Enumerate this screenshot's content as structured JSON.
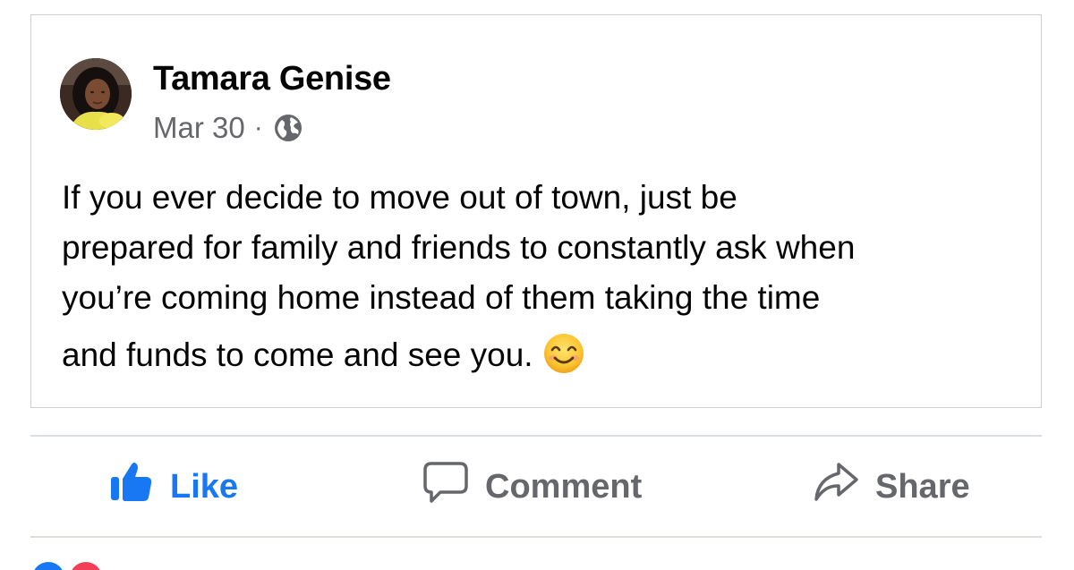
{
  "post": {
    "author": "Tamara Genise",
    "date": "Mar 30",
    "separator": "·",
    "audience_icon": "globe-icon",
    "avatar_icon": "profile-photo",
    "text_lines": [
      "If you ever decide to move out of town, just be",
      "prepared for family and friends to constantly ask when",
      "you’re coming home instead of them taking the time",
      "and funds to come and see you."
    ],
    "emoji_icon": "smiling-face-icon"
  },
  "actions": {
    "like_label": "Like",
    "comment_label": "Comment",
    "share_label": "Share",
    "like_icon": "thumbs-up-icon",
    "comment_icon": "speech-bubble-icon",
    "share_icon": "share-arrow-icon"
  },
  "colors": {
    "like_blue": "#1877f2",
    "secondary_gray": "#65676b",
    "text_black": "#050505",
    "border_gray": "#cfcfcf"
  }
}
